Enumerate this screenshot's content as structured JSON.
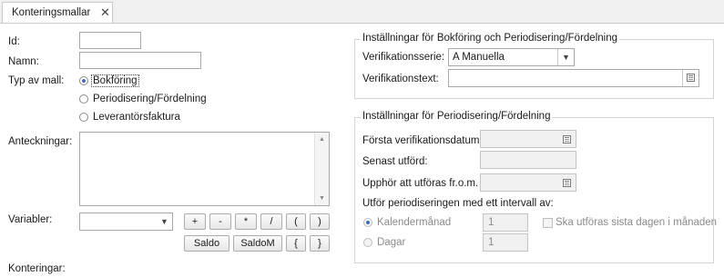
{
  "tab": {
    "label": "Konteringsmallar",
    "close": "✕"
  },
  "form": {
    "id_label": "Id:",
    "id_value": "",
    "name_label": "Namn:",
    "name_value": "",
    "type_label": "Typ av mall:",
    "type_options": [
      {
        "label": "Bokföring",
        "selected": true
      },
      {
        "label": "Periodisering/Fördelning",
        "selected": false
      },
      {
        "label": "Leverantörsfaktura",
        "selected": false
      }
    ],
    "notes_label": "Anteckningar:",
    "notes_value": "",
    "variables_label": "Variabler:",
    "variables_value": "",
    "entries_label": "Konteringar:"
  },
  "operators": {
    "plus": "+",
    "minus": "-",
    "times": "*",
    "divide": "/",
    "paren_open": "(",
    "paren_close": ")",
    "saldo": "Saldo",
    "saldom": "SaldoM",
    "brace_open": "{",
    "brace_close": "}"
  },
  "booking_group": {
    "title": "Inställningar för Bokföring och Periodisering/Fördelning",
    "series_label": "Verifikationsserie:",
    "series_value": "A  Manuella",
    "text_label": "Verifikationstext:",
    "text_value": ""
  },
  "period_group": {
    "title": "Inställningar för Periodisering/Fördelning",
    "first_date_label": "Första verifikationsdatum:",
    "first_date_value": "",
    "last_done_label": "Senast utförd:",
    "last_done_value": "",
    "stop_label": "Upphör att utföras fr.o.m.",
    "stop_value": "",
    "interval_label": "Utför periodiseringen med ett intervall av:",
    "month_label": "Kalendermånad",
    "month_value": "1",
    "last_day_label": "Ska utföras sista dagen i månaden",
    "day_label": "Dagar",
    "day_value": "1"
  },
  "icons": {
    "close": "close-icon",
    "dropdown": "chevron-down-icon",
    "calendar": "calendar-icon",
    "text_picker": "list-icon"
  },
  "colors": {
    "selected_radio": "#3b6fb6",
    "disabled_bg": "#f0f0f0"
  }
}
